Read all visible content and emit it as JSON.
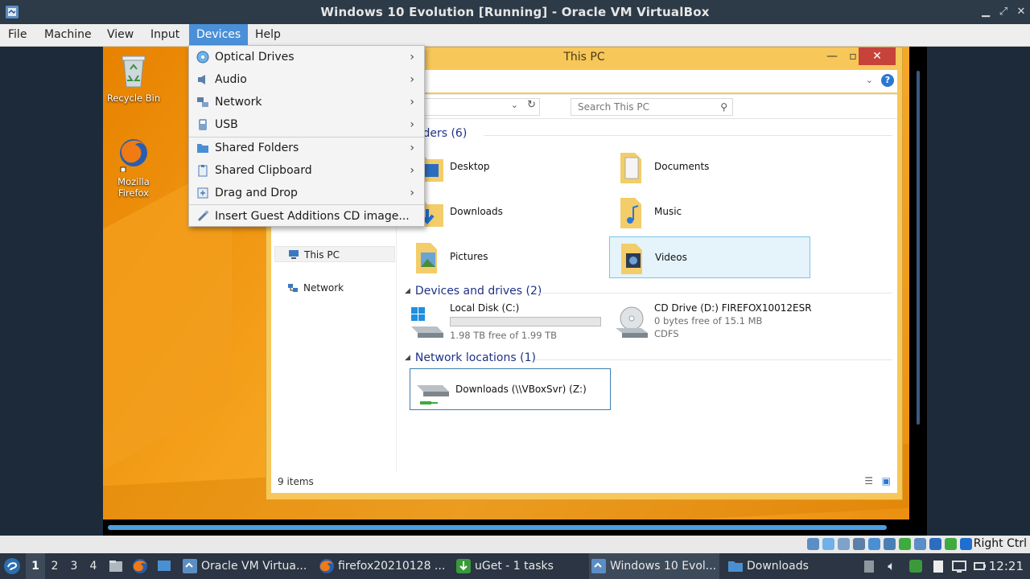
{
  "host": {
    "title": "Windows 10 Evolution [Running] - Oracle VM VirtualBox",
    "menu": [
      "File",
      "Machine",
      "View",
      "Input",
      "Devices",
      "Help"
    ],
    "active_menu": "Devices"
  },
  "devices_menu": {
    "items": [
      {
        "label": "Optical Drives",
        "icon": "optical-drive-icon",
        "submenu": true
      },
      {
        "label": "Audio",
        "icon": "audio-icon",
        "submenu": true
      },
      {
        "label": "Network",
        "icon": "network-icon",
        "submenu": true
      },
      {
        "label": "USB",
        "icon": "usb-icon",
        "submenu": true
      },
      {
        "label": "Shared Folders",
        "icon": "shared-folder-icon",
        "submenu": true
      },
      {
        "label": "Shared Clipboard",
        "icon": "clipboard-icon",
        "submenu": true
      },
      {
        "label": "Drag and Drop",
        "icon": "drag-drop-icon",
        "submenu": true
      },
      {
        "label": "Insert Guest Additions CD image...",
        "icon": "guest-additions-icon",
        "submenu": false
      }
    ]
  },
  "guest": {
    "desktop_icons": [
      {
        "label": "Recycle Bin",
        "icon": "recycle-bin-icon"
      },
      {
        "label": "Mozilla Firefox",
        "icon": "firefox-icon"
      }
    ],
    "explorer": {
      "title": "This PC",
      "search_placeholder": "Search This PC",
      "nav": [
        {
          "label": "This PC",
          "icon": "computer-icon",
          "selected": true
        },
        {
          "label": "Network",
          "icon": "network-icon",
          "selected": false
        }
      ],
      "folders_header": "olders (6)",
      "folders": [
        {
          "name": "Desktop",
          "icon": "desktop-folder-icon",
          "selected": false
        },
        {
          "name": "Documents",
          "icon": "documents-folder-icon",
          "selected": false
        },
        {
          "name": "Downloads",
          "icon": "downloads-folder-icon",
          "selected": false
        },
        {
          "name": "Music",
          "icon": "music-folder-icon",
          "selected": false
        },
        {
          "name": "Pictures",
          "icon": "pictures-folder-icon",
          "selected": false
        },
        {
          "name": "Videos",
          "icon": "videos-folder-icon",
          "selected": true
        }
      ],
      "drives_header": "Devices and drives (2)",
      "drives": [
        {
          "name": "Local Disk (C:)",
          "free": "1.98 TB free of 1.99 TB",
          "used_fraction": 0.005,
          "icon": "local-disk-icon"
        },
        {
          "name": "CD Drive (D:) FIREFOX10012ESR",
          "free": "0 bytes free of 15.1 MB",
          "fs": "CDFS",
          "icon": "cd-drive-icon"
        }
      ],
      "network_header": "Network locations (1)",
      "network": [
        {
          "name": "Downloads (\\\\VBoxSvr) (Z:)",
          "icon": "network-drive-icon"
        }
      ],
      "status": "9 items"
    }
  },
  "vbox_status": {
    "host_key": "Right Ctrl"
  },
  "taskbar": {
    "workspaces": [
      "1",
      "2",
      "3",
      "4"
    ],
    "active_workspace": "1",
    "tasks": [
      {
        "label": "Oracle VM Virtua...",
        "icon": "virtualbox-icon"
      },
      {
        "label": "firefox20210128 ...",
        "icon": "firefox-icon"
      },
      {
        "label": "uGet - 1 tasks",
        "icon": "uget-icon"
      },
      {
        "label": "Windows 10 Evol...",
        "icon": "virtualbox-icon"
      },
      {
        "label": "Downloads",
        "icon": "folder-icon"
      }
    ],
    "clock": "12:21"
  }
}
